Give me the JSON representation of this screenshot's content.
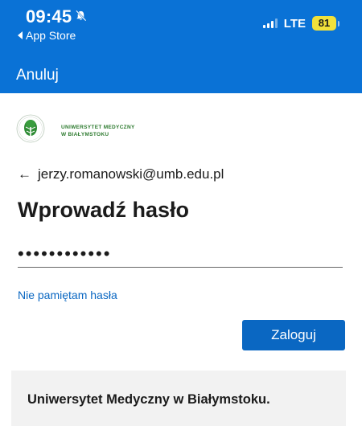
{
  "status_bar": {
    "time": "09:45",
    "back_app": "App Store",
    "network": "LTE",
    "battery": "81"
  },
  "nav": {
    "cancel_label": "Anuluj"
  },
  "logo": {
    "line1": "UNIWERSYTET MEDYCZNY",
    "line2": "W BIAŁYMSTOKU"
  },
  "account": {
    "email": "jerzy.romanowski@umb.edu.pl"
  },
  "form": {
    "title": "Wprowadź hasło",
    "password_mask": "••••••••••••",
    "forgot_label": "Nie pamiętam hasła",
    "submit_label": "Zaloguj"
  },
  "footer": {
    "text": "Uniwersytet Medyczny w Białymstoku."
  },
  "colors": {
    "header_blue": "#0a72d6",
    "button_blue": "#0a67c2",
    "logo_green": "#2c7a2e",
    "battery_yellow": "#f1e13a"
  },
  "icons": [
    "silent-bell-icon",
    "back-triangle-icon",
    "signal-icon",
    "battery-icon",
    "university-seal-icon",
    "arrow-left-icon"
  ]
}
